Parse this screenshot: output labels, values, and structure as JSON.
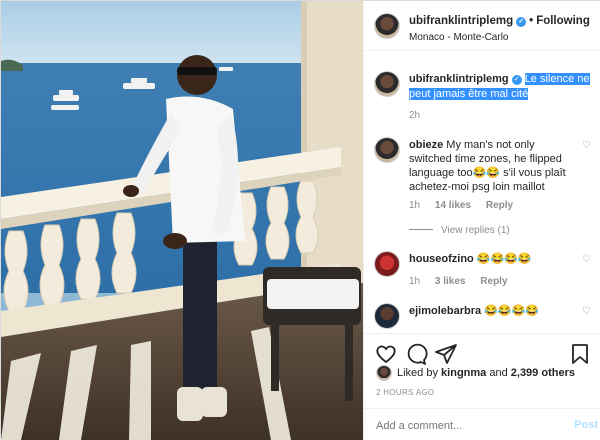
{
  "header": {
    "username": "ubifranklintriplemg",
    "follow_label": "Following",
    "location": "Monaco - Monte-Carlo",
    "verified_icon": "check-icon"
  },
  "caption": {
    "username": "ubifranklintriplemg",
    "text": "Le silence ne peut jamais être mal cité",
    "time": "2h"
  },
  "comments": [
    {
      "username": "obieze",
      "text": "My man's not only switched time zones, he flipped language too😂😂 s'il vous plaît achetez-moi psg loin maillot",
      "time": "1h",
      "likes": "14 likes",
      "reply": "Reply",
      "view_replies": "View replies (1)"
    },
    {
      "username": "houseofzino",
      "text": "😂😂😂😂",
      "time": "1h",
      "likes": "3 likes",
      "reply": "Reply"
    },
    {
      "username": "ejimolebarbra",
      "text": "😂😂😂😂"
    }
  ],
  "likes": {
    "prefix": "Liked by",
    "user": "kingnma",
    "connector": "and",
    "count": "2,399 others"
  },
  "time_ago": "2 HOURS AGO",
  "add_comment": {
    "placeholder": "Add a comment...",
    "post_label": "Post"
  },
  "colors": {
    "verified": "#3897f0",
    "highlight": "#3390ff",
    "muted": "#8e8e8e",
    "post_disabled": "#b2dffc"
  }
}
